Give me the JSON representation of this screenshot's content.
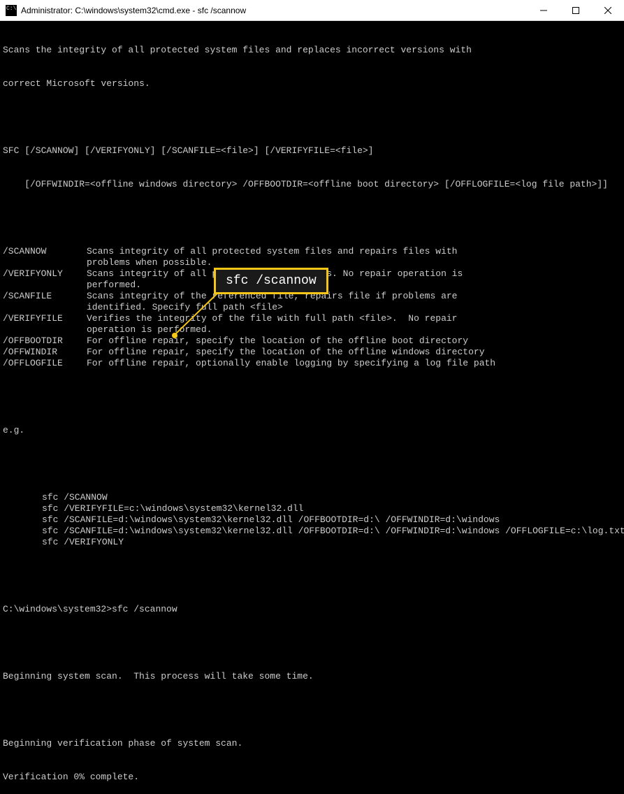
{
  "title_bar": {
    "title": "Administrator: C:\\windows\\system32\\cmd.exe - sfc  /scannow"
  },
  "intro": {
    "line1": "Scans the integrity of all protected system files and replaces incorrect versions with",
    "line2": "correct Microsoft versions."
  },
  "usage": {
    "line1": "SFC [/SCANNOW] [/VERIFYONLY] [/SCANFILE=<file>] [/VERIFYFILE=<file>]",
    "line2": "    [/OFFWINDIR=<offline windows directory> /OFFBOOTDIR=<offline boot directory> [/OFFLOGFILE=<log file path>]]"
  },
  "options": [
    {
      "name": "/SCANNOW",
      "desc": "Scans integrity of all protected system files and repairs files with\nproblems when possible."
    },
    {
      "name": "/VERIFYONLY",
      "desc": "Scans integrity of all protected system files. No repair operation is\nperformed."
    },
    {
      "name": "/SCANFILE",
      "desc": "Scans integrity of the referenced file, repairs file if problems are\nidentified. Specify full path <file>"
    },
    {
      "name": "/VERIFYFILE",
      "desc": "Verifies the integrity of the file with full path <file>.  No repair\noperation is performed."
    },
    {
      "name": "/OFFBOOTDIR",
      "desc": "For offline repair, specify the location of the offline boot directory"
    },
    {
      "name": "/OFFWINDIR",
      "desc": "For offline repair, specify the location of the offline windows directory"
    },
    {
      "name": "/OFFLOGFILE",
      "desc": "For offline repair, optionally enable logging by specifying a log file path"
    }
  ],
  "eg": {
    "header": "e.g.",
    "lines": [
      "sfc /SCANNOW",
      "sfc /VERIFYFILE=c:\\windows\\system32\\kernel32.dll",
      "sfc /SCANFILE=d:\\windows\\system32\\kernel32.dll /OFFBOOTDIR=d:\\ /OFFWINDIR=d:\\windows",
      "sfc /SCANFILE=d:\\windows\\system32\\kernel32.dll /OFFBOOTDIR=d:\\ /OFFWINDIR=d:\\windows /OFFLOGFILE=c:\\log.txt",
      "sfc /VERIFYONLY"
    ]
  },
  "prompt": {
    "path": "C:\\windows\\system32>",
    "command": "sfc /scannow"
  },
  "output": {
    "line1": "Beginning system scan.  This process will take some time.",
    "line2": "Beginning verification phase of system scan.",
    "line3": "Verification 0% complete."
  },
  "callout": {
    "text": "sfc /scannow"
  }
}
